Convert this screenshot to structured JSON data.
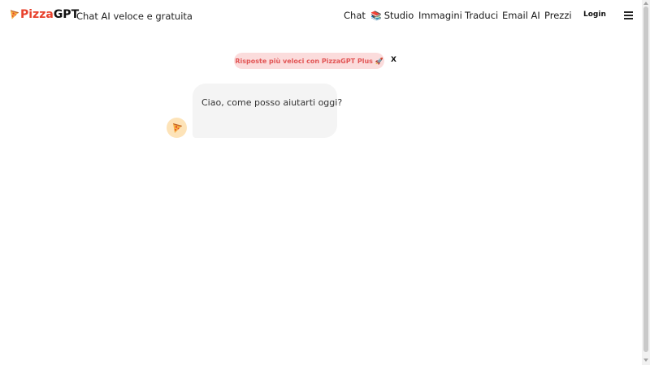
{
  "header": {
    "brand": {
      "pizza": "Pizza",
      "gpt": "GPT",
      "icon": "pizza-slice-icon",
      "brand_color": "#e8412c"
    },
    "tagline": "Chat AI veloce e gratuita",
    "nav": {
      "chat": "Chat",
      "studio_icon": "📚",
      "studio": "Studio",
      "images": "Immagini",
      "translate": "Traduci",
      "email": "Email AI",
      "prices": "Prezzi"
    },
    "login": "Login",
    "menu_icon": "hamburger-menu-icon"
  },
  "promo": {
    "text": "Risposte più veloci con PizzaGPT Plus 🚀",
    "close": "X",
    "background": "#fbdcdc",
    "text_color": "#e25555"
  },
  "chat": {
    "messages": [
      {
        "sender_icon": "pizza-slice-icon",
        "text": "Ciao, come posso aiutarti oggi?"
      }
    ]
  }
}
